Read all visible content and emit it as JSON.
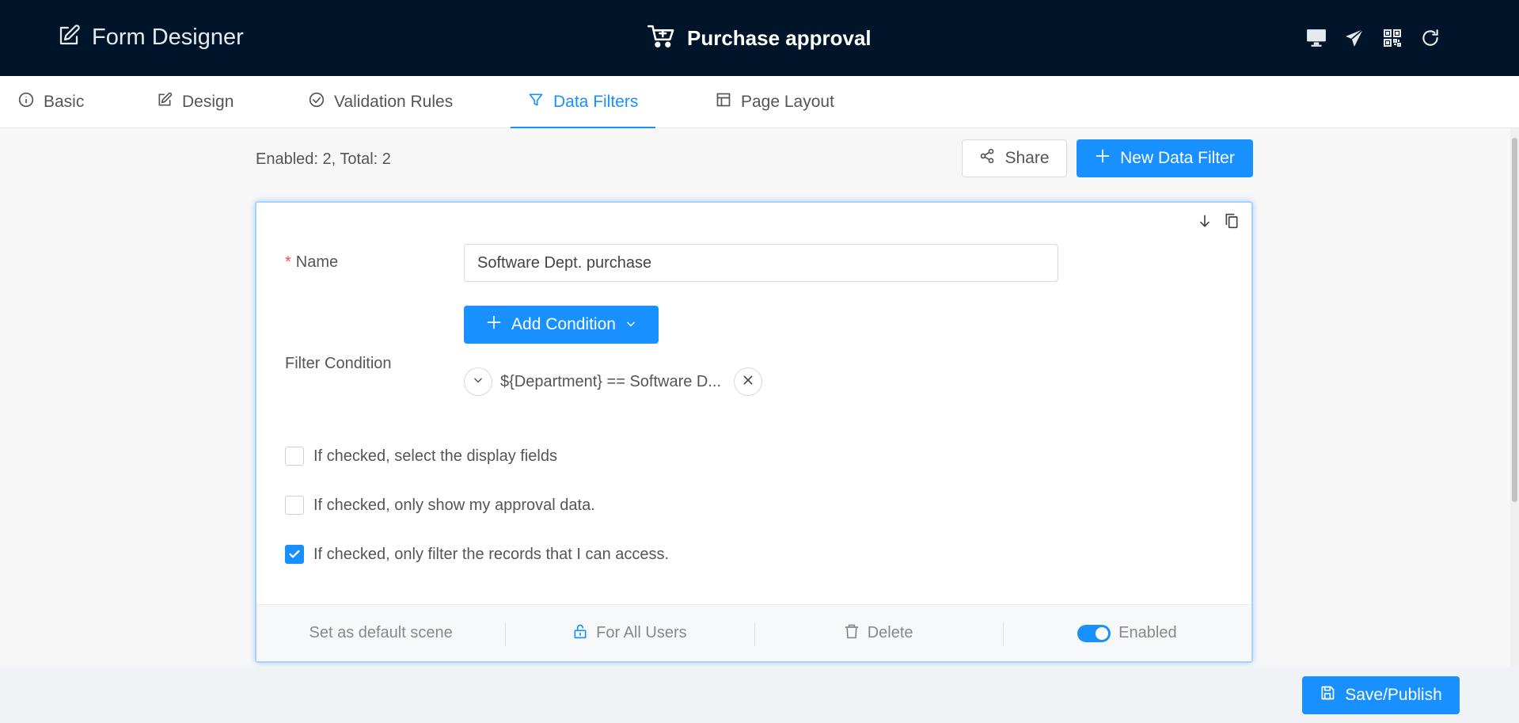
{
  "header": {
    "app_title": "Form Designer",
    "page_title": "Purchase approval",
    "actions": [
      "desktop-preview",
      "send",
      "qr-code",
      "refresh"
    ]
  },
  "tabs": [
    {
      "label": "Basic",
      "icon": "info-icon"
    },
    {
      "label": "Design",
      "icon": "edit-icon"
    },
    {
      "label": "Validation Rules",
      "icon": "check-circle-icon"
    },
    {
      "label": "Data Filters",
      "icon": "filter-icon",
      "active": true
    },
    {
      "label": "Page Layout",
      "icon": "layout-icon"
    }
  ],
  "toolbar": {
    "stats": "Enabled: 2, Total: 2",
    "share_label": "Share",
    "new_label": "New Data Filter"
  },
  "filter": {
    "name_label": "Name",
    "name_value": "Software Dept. purchase",
    "condition_label": "Filter Condition",
    "add_condition_label": "Add Condition",
    "condition_text": "${Department} == Software D...",
    "checkboxes": [
      {
        "label": "If checked, select the display fields",
        "checked": false
      },
      {
        "label": "If checked, only show my approval data.",
        "checked": false
      },
      {
        "label": "If checked, only filter the records that I can access.",
        "checked": true
      }
    ],
    "footer": {
      "default_scene": "Set as default scene",
      "users": "For All Users",
      "delete": "Delete",
      "enabled": "Enabled"
    }
  },
  "save_label": "Save/Publish",
  "colors": {
    "topbar": "#001529",
    "accent": "#1890ff",
    "required": "#ff4d4f"
  }
}
